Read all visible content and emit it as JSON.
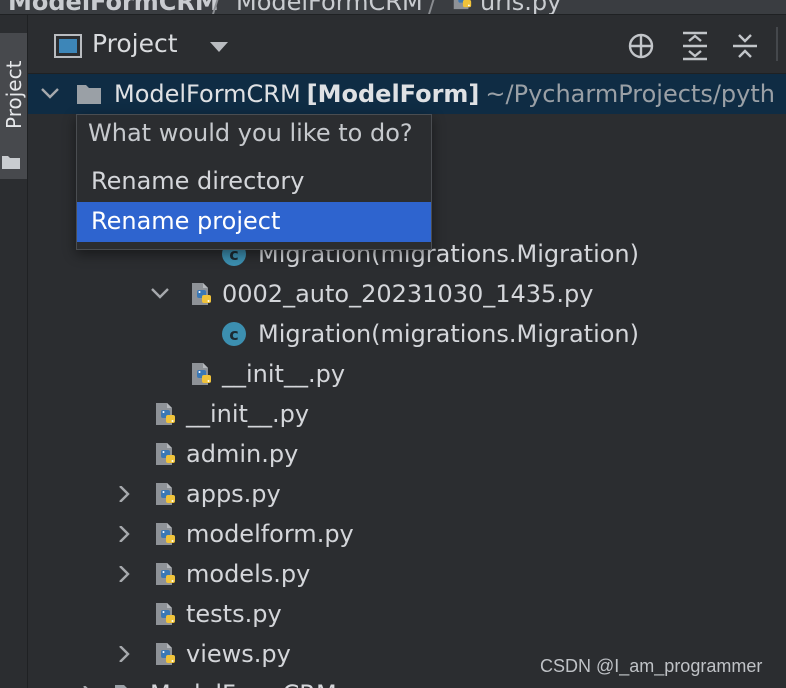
{
  "breadcrumbs": {
    "items": [
      "ModelFormCRM",
      "ModelFormCRM",
      "urls.py"
    ]
  },
  "sidebar": {
    "tab_label": "Project"
  },
  "toolbar": {
    "title": "Project",
    "buttons": [
      "locate-icon",
      "expand-all-icon",
      "collapse-all-icon"
    ]
  },
  "tree": {
    "root": {
      "name": "ModelFormCRM",
      "module": "[ModelForm]",
      "path": "~/PycharmProjects/pyth"
    },
    "rows": [
      {
        "label": "Migration(migrations.Migration)",
        "icon": "class-icon"
      },
      {
        "label": "0002_auto_20231030_1435.py",
        "icon": "python-file-icon",
        "expanded": true
      },
      {
        "label": "Migration(migrations.Migration)",
        "icon": "class-icon"
      },
      {
        "label": "__init__.py",
        "icon": "python-file-icon"
      },
      {
        "label": "__init__.py",
        "icon": "python-file-icon"
      },
      {
        "label": "admin.py",
        "icon": "python-file-icon"
      },
      {
        "label": "apps.py",
        "icon": "python-file-icon",
        "collapsed": true
      },
      {
        "label": "modelform.py",
        "icon": "python-file-icon",
        "collapsed": true
      },
      {
        "label": "models.py",
        "icon": "python-file-icon",
        "collapsed": true
      },
      {
        "label": "tests.py",
        "icon": "python-file-icon"
      },
      {
        "label": "views.py",
        "icon": "python-file-icon",
        "collapsed": true
      },
      {
        "label": "ModelFormCRM",
        "icon": "folder-icon",
        "collapsed": true
      }
    ]
  },
  "popup": {
    "prompt": "What would you like to do?",
    "options": [
      "Rename directory",
      "Rename project"
    ],
    "selected_index": 1
  },
  "watermark": "CSDN @I_am_programmer",
  "colors": {
    "background": "#2b2d30",
    "selected_row": "#0f2c44",
    "popup_selection": "#2e64cf",
    "class_icon": "#3c8fb0"
  }
}
